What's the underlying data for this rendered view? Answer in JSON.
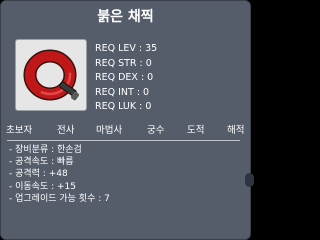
{
  "item": {
    "name": "붉은 채찍",
    "icon": "red-whip-icon",
    "requirements": [
      {
        "label": "REQ LEV : 35"
      },
      {
        "label": "REQ STR : 0"
      },
      {
        "label": "REQ DEX : 0"
      },
      {
        "label": "REQ INT : 0"
      },
      {
        "label": "REQ LUK : 0"
      }
    ],
    "classes": [
      "초보자",
      "전사",
      "마법사",
      "궁수",
      "도적",
      "해적"
    ],
    "stats": [
      "- 장비분류 : 한손검",
      "- 공격속도 : 빠름",
      "- 공격력 : +48",
      "- 이동속도 : +15",
      "- 업그레이드 가능 횟수 : 7"
    ]
  },
  "colors": {
    "panel": "#555d6b",
    "icon_red": "#c01818",
    "icon_handle": "#3a3a3a"
  }
}
